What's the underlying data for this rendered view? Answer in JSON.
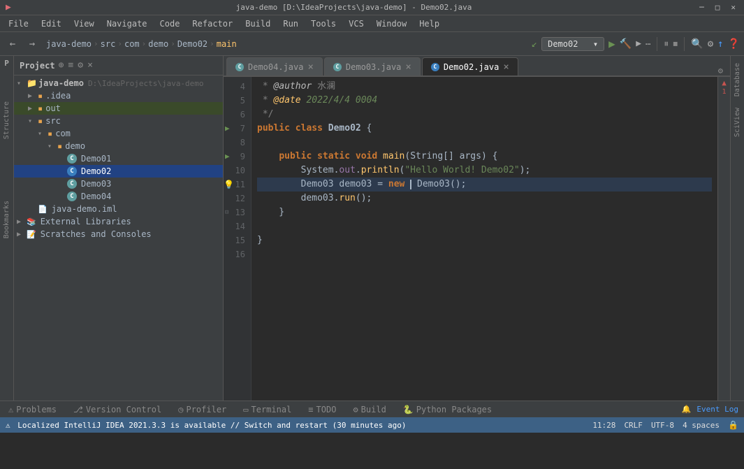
{
  "titlebar": {
    "title": "java-demo [D:\\IdeaProjects\\java-demo] - Demo02.java",
    "app": "java-demo"
  },
  "menubar": {
    "items": [
      "File",
      "Edit",
      "View",
      "Navigate",
      "Code",
      "Refactor",
      "Build",
      "Run",
      "Tools",
      "VCS",
      "Window",
      "Help"
    ]
  },
  "breadcrumb": {
    "items": [
      "java-demo",
      "src",
      "com",
      "demo",
      "Demo02",
      "main"
    ]
  },
  "toolbar": {
    "run_config": "Demo02",
    "chevron": "▾"
  },
  "tabs": [
    {
      "label": "Demo04.java",
      "active": false
    },
    {
      "label": "Demo03.java",
      "active": false
    },
    {
      "label": "Demo02.java",
      "active": true
    }
  ],
  "filetree": {
    "project_label": "Project",
    "root": "java-demo",
    "root_path": "D:\\IdeaProjects\\java-demo",
    "items": [
      {
        "indent": 0,
        "type": "root",
        "label": "java-demo",
        "path": "D:\\IdeaProjects\\java-demo",
        "expanded": true
      },
      {
        "indent": 1,
        "type": "folder",
        "label": ".idea",
        "expanded": false
      },
      {
        "indent": 1,
        "type": "folder",
        "label": "out",
        "expanded": false,
        "selected_parent": true
      },
      {
        "indent": 1,
        "type": "folder",
        "label": "src",
        "expanded": true
      },
      {
        "indent": 2,
        "type": "folder",
        "label": "com",
        "expanded": true
      },
      {
        "indent": 3,
        "type": "folder",
        "label": "demo",
        "expanded": true,
        "selected_parent": true
      },
      {
        "indent": 4,
        "type": "java",
        "label": "Demo01"
      },
      {
        "indent": 4,
        "type": "java",
        "label": "Demo02",
        "selected": true
      },
      {
        "indent": 4,
        "type": "java",
        "label": "Demo03"
      },
      {
        "indent": 4,
        "type": "java",
        "label": "Demo04"
      },
      {
        "indent": 1,
        "type": "iml",
        "label": "java-demo.iml"
      },
      {
        "indent": 0,
        "type": "external",
        "label": "External Libraries"
      },
      {
        "indent": 0,
        "type": "scratches",
        "label": "Scratches and Consoles"
      }
    ]
  },
  "code": {
    "lines": [
      {
        "num": 4,
        "content": " * @author 水澜",
        "type": "comment"
      },
      {
        "num": 5,
        "content": " * @date 2022/4/4 0004",
        "type": "comment-annotation"
      },
      {
        "num": 6,
        "content": " */",
        "type": "comment"
      },
      {
        "num": 7,
        "content": "public class Demo02 {",
        "type": "class-decl"
      },
      {
        "num": 8,
        "content": "",
        "type": "empty"
      },
      {
        "num": 9,
        "content": "    public static void main(String[] args) {",
        "type": "method-decl"
      },
      {
        "num": 10,
        "content": "        System.out.println(\"Hello World! Demo02\");",
        "type": "code"
      },
      {
        "num": 11,
        "content": "        Demo03 demo03 = new Demo03();",
        "type": "code-cursor"
      },
      {
        "num": 12,
        "content": "        demo03.run();",
        "type": "code"
      },
      {
        "num": 13,
        "content": "    }",
        "type": "code"
      },
      {
        "num": 14,
        "content": "",
        "type": "empty"
      },
      {
        "num": 15,
        "content": "}",
        "type": "code"
      },
      {
        "num": 16,
        "content": "",
        "type": "empty"
      }
    ]
  },
  "bottom_tabs": [
    {
      "icon": "⚠",
      "label": "Problems"
    },
    {
      "icon": "⎇",
      "label": "Version Control"
    },
    {
      "icon": "◷",
      "label": "Profiler"
    },
    {
      "icon": "▭",
      "label": "Terminal"
    },
    {
      "icon": "≡",
      "label": "TODO"
    },
    {
      "icon": "⚙",
      "label": "Build"
    },
    {
      "icon": "🐍",
      "label": "Python Packages"
    }
  ],
  "statusbar": {
    "message": "Localized IntelliJ IDEA 2021.3.3 is available // Switch and restart (30 minutes ago)",
    "line_col": "11:28",
    "line_sep": "CRLF",
    "encoding": "UTF-8",
    "indent": "4 spaces",
    "event_log": "Event Log",
    "warning_icon": "⚠",
    "warning_count": "1"
  },
  "right_sidebars": [
    "Database",
    "SciView"
  ],
  "icons": {
    "run": "▶",
    "debug": "🐛",
    "chevron_down": "▾",
    "chevron_right": "▶",
    "close": "×",
    "search": "🔍",
    "gear": "⚙",
    "plus": "+",
    "collapse": "−",
    "expand": "+"
  }
}
